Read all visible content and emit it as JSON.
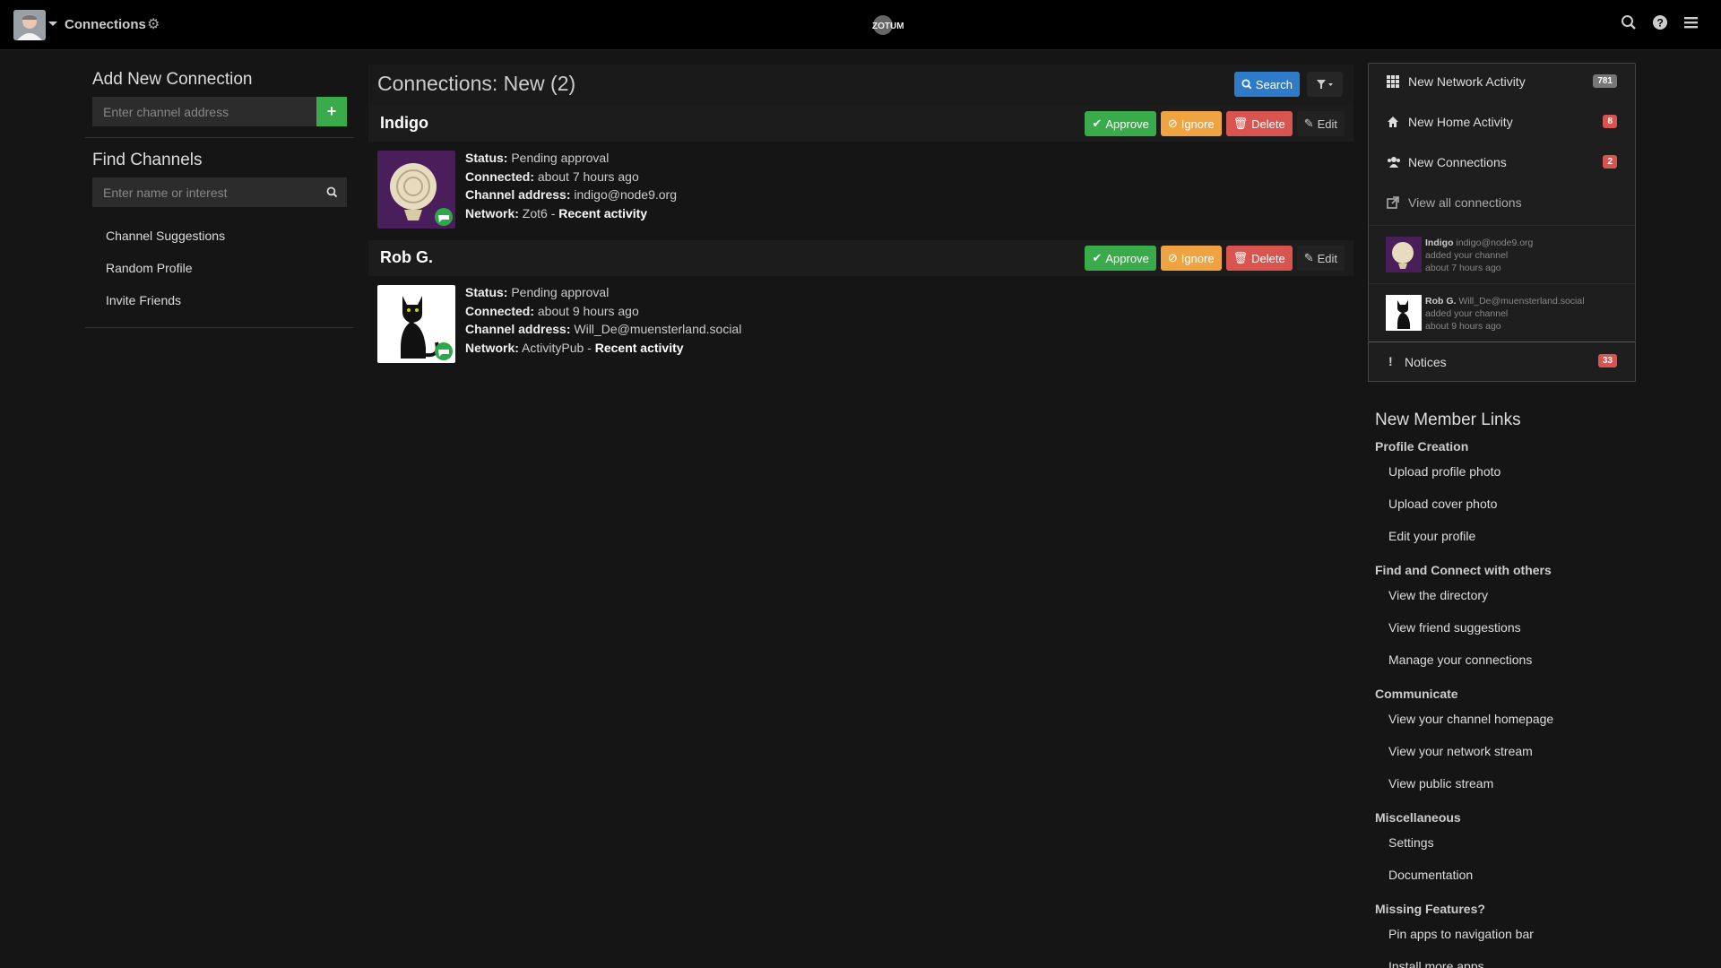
{
  "navbar": {
    "title": "Connections",
    "logo_text": "ZOTUM",
    "icons": [
      "search-icon",
      "help-icon",
      "menu-icon"
    ]
  },
  "left": {
    "add_heading": "Add New Connection",
    "add_placeholder": "Enter channel address",
    "add_button": "+",
    "find_heading": "Find Channels",
    "find_placeholder": "Enter name or interest",
    "links": [
      "Channel Suggestions",
      "Random Profile",
      "Invite Friends"
    ]
  },
  "main": {
    "title": "Connections: New (2)",
    "search_button": "Search",
    "actions": {
      "approve": "Approve",
      "ignore": "Ignore",
      "delete": "Delete",
      "edit": "Edit"
    },
    "labels": {
      "status": "Status:",
      "connected": "Connected:",
      "address": "Channel address:",
      "network": "Network:",
      "recent": "Recent activity",
      "sep": " - "
    },
    "connections": [
      {
        "name": "Indigo",
        "status": "Pending approval",
        "connected": "about 7 hours ago",
        "address": "indigo@node9.org",
        "network": "Zot6"
      },
      {
        "name": "Rob G.",
        "status": "Pending approval",
        "connected": "about 9 hours ago",
        "address": "Will_De@muensterland.social",
        "network": "ActivityPub"
      }
    ]
  },
  "right": {
    "notifications": [
      {
        "label": "New Network Activity",
        "count": "781",
        "icon": "grid-icon",
        "badge_color": "#777777"
      },
      {
        "label": "New Home Activity",
        "count": "8",
        "icon": "home-icon",
        "badge_color": "#d9534f"
      },
      {
        "label": "New Connections",
        "count": "2",
        "icon": "users-icon",
        "badge_color": "#d9534f"
      }
    ],
    "view_all": "View all connections",
    "recent": [
      {
        "name": "Indigo",
        "address": "indigo@node9.org",
        "action": "added your channel",
        "time": "about 7 hours ago"
      },
      {
        "name": "Rob G.",
        "address": "Will_De@muensterland.social",
        "action": "added your channel",
        "time": "about 9 hours ago"
      }
    ],
    "notices_label": "Notices",
    "notices_count": "33",
    "member_links_heading": "New Member Links",
    "sections": [
      {
        "title": "Profile Creation",
        "links": [
          "Upload profile photo",
          "Upload cover photo",
          "Edit your profile"
        ]
      },
      {
        "title": "Find and Connect with others",
        "links": [
          "View the directory",
          "View friend suggestions",
          "Manage your connections"
        ]
      },
      {
        "title": "Communicate",
        "links": [
          "View your channel homepage",
          "View your network stream",
          "View public stream"
        ]
      },
      {
        "title": "Miscellaneous",
        "links": [
          "Settings",
          "Documentation"
        ]
      },
      {
        "title": "Missing Features?",
        "links": [
          "Pin apps to navigation bar",
          "Install more apps"
        ]
      }
    ]
  }
}
